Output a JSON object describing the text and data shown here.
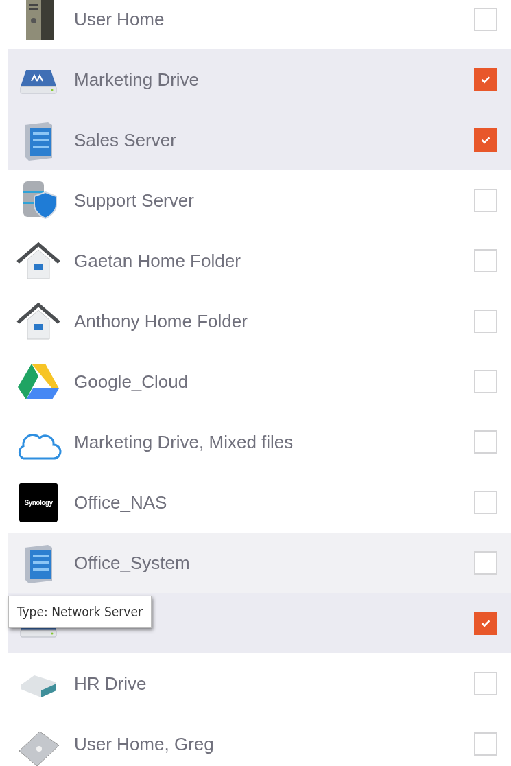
{
  "items": [
    {
      "label": "User Home",
      "kind": "tower",
      "checked": false,
      "hovered": false
    },
    {
      "label": "Marketing Drive",
      "kind": "drive",
      "checked": true,
      "hovered": false
    },
    {
      "label": "Sales Server",
      "kind": "server",
      "checked": true,
      "hovered": false
    },
    {
      "label": "Support Server",
      "kind": "shield-server",
      "checked": false,
      "hovered": false
    },
    {
      "label": "Gaetan Home Folder",
      "kind": "house",
      "checked": false,
      "hovered": false
    },
    {
      "label": "Anthony Home Folder",
      "kind": "house",
      "checked": false,
      "hovered": false
    },
    {
      "label": "Google_Cloud",
      "kind": "triangle",
      "checked": false,
      "hovered": false
    },
    {
      "label": "Marketing Drive, Mixed files",
      "kind": "cloud",
      "checked": false,
      "hovered": false
    },
    {
      "label": "Office_NAS",
      "kind": "nas",
      "badge_text": "Synology",
      "checked": false,
      "hovered": false
    },
    {
      "label": "Office_System",
      "kind": "server",
      "checked": false,
      "hovered": true
    },
    {
      "kind": "drive",
      "checked": true,
      "hovered": false,
      "tooltip": "Type: Network Server"
    },
    {
      "label": "HR Drive",
      "kind": "hdd",
      "checked": false,
      "hovered": false
    },
    {
      "label": "User Home, Greg",
      "kind": "laptop",
      "checked": false,
      "hovered": false
    }
  ]
}
